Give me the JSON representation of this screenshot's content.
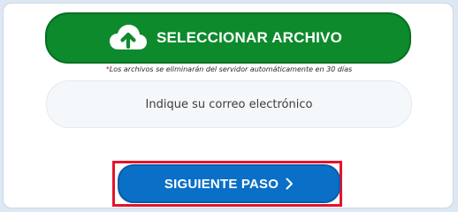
{
  "upload": {
    "label": "SELECCIONAR ARCHIVO",
    "icon": "cloud-upload-icon"
  },
  "notice": {
    "marker": "*",
    "text": "Los archivos se eliminarán del servidor automáticamente en 30 días"
  },
  "email": {
    "placeholder": "Indique su correo electrónico",
    "value": ""
  },
  "next": {
    "label": "SIGUIENTE PASO",
    "icon": "chevron-right-icon"
  },
  "colors": {
    "upload_button": "#0d8a2c",
    "next_button": "#0a6fc7",
    "highlight": "#e5132a",
    "notice_marker": "#d02020"
  }
}
